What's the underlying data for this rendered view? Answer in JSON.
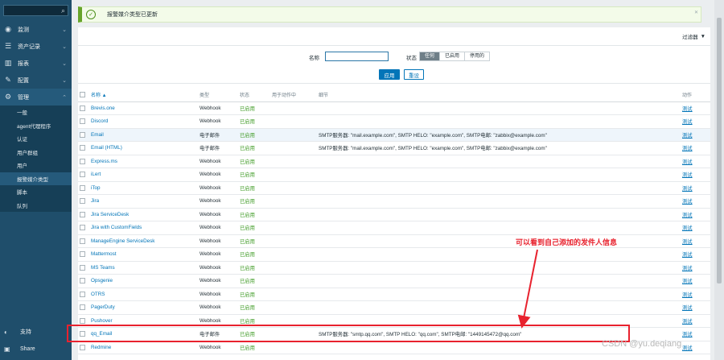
{
  "sidebar": {
    "search_placeholder": "",
    "nav": [
      {
        "label": "监测",
        "icon": "eye-icon",
        "glyph": "◉"
      },
      {
        "label": "资产记录",
        "icon": "list-icon",
        "glyph": "☰"
      },
      {
        "label": "报表",
        "icon": "bar-chart-icon",
        "glyph": "▥"
      },
      {
        "label": "配置",
        "icon": "wrench-icon",
        "glyph": "✎"
      },
      {
        "label": "管理",
        "icon": "gear-icon",
        "glyph": "⚙"
      }
    ],
    "sub_items": [
      "一般",
      "agent代理程序",
      "认证",
      "用户群组",
      "用户",
      "报警媒介类型",
      "脚本",
      "队列"
    ],
    "selected_sub": "报警媒介类型",
    "footer": [
      {
        "label": "支持",
        "icon": "support-icon",
        "glyph": "◐"
      },
      {
        "label": "Share",
        "icon": "share-icon",
        "glyph": "▣"
      }
    ]
  },
  "message": {
    "text": "报警媒介类型已更新"
  },
  "filter": {
    "button_label": "过滤器",
    "name_label": "名称",
    "name_value": "",
    "status_label": "状态",
    "status_options": [
      "任何",
      "已启用",
      "停用的"
    ],
    "status_selected": "任何",
    "apply_label": "应用",
    "reset_label": "重设"
  },
  "table": {
    "columns": [
      "名称 ▲",
      "类型",
      "状态",
      "用于动作中",
      "细节",
      "动作"
    ],
    "rows": [
      {
        "name": "Brevis.one",
        "type": "Webhook",
        "status": "已启用",
        "details": "",
        "action": "测试"
      },
      {
        "name": "Discord",
        "type": "Webhook",
        "status": "已启用",
        "details": "",
        "action": "测试"
      },
      {
        "name": "Email",
        "type": "电子邮件",
        "status": "已启用",
        "details": "SMTP服务器: \"mail.example.com\", SMTP HELO: \"example.com\", SMTP电邮: \"zabbix@example.com\"",
        "action": "测试"
      },
      {
        "name": "Email (HTML)",
        "type": "电子邮件",
        "status": "已启用",
        "details": "SMTP服务器: \"mail.example.com\", SMTP HELO: \"example.com\", SMTP电邮: \"zabbix@example.com\"",
        "action": "测试"
      },
      {
        "name": "Express.ms",
        "type": "Webhook",
        "status": "已启用",
        "details": "",
        "action": "测试"
      },
      {
        "name": "iLert",
        "type": "Webhook",
        "status": "已启用",
        "details": "",
        "action": "测试"
      },
      {
        "name": "iTop",
        "type": "Webhook",
        "status": "已启用",
        "details": "",
        "action": "测试"
      },
      {
        "name": "Jira",
        "type": "Webhook",
        "status": "已启用",
        "details": "",
        "action": "测试"
      },
      {
        "name": "Jira ServiceDesk",
        "type": "Webhook",
        "status": "已启用",
        "details": "",
        "action": "测试"
      },
      {
        "name": "Jira with CustomFields",
        "type": "Webhook",
        "status": "已启用",
        "details": "",
        "action": "测试"
      },
      {
        "name": "ManageEngine ServiceDesk",
        "type": "Webhook",
        "status": "已启用",
        "details": "",
        "action": "测试"
      },
      {
        "name": "Mattermost",
        "type": "Webhook",
        "status": "已启用",
        "details": "",
        "action": "测试"
      },
      {
        "name": "MS Teams",
        "type": "Webhook",
        "status": "已启用",
        "details": "",
        "action": "测试"
      },
      {
        "name": "Opsgenie",
        "type": "Webhook",
        "status": "已启用",
        "details": "",
        "action": "测试"
      },
      {
        "name": "OTRS",
        "type": "Webhook",
        "status": "已启用",
        "details": "",
        "action": "测试"
      },
      {
        "name": "PagerDuty",
        "type": "Webhook",
        "status": "已启用",
        "details": "",
        "action": "测试"
      },
      {
        "name": "Pushover",
        "type": "Webhook",
        "status": "已启用",
        "details": "",
        "action": "测试"
      },
      {
        "name": "qq_Email",
        "type": "电子邮件",
        "status": "已启用",
        "details": "SMTP服务器: \"smtp.qq.com\", SMTP HELO: \"qq.com\", SMTP电邮: \"1449145472@qq.com\"",
        "action": "测试"
      },
      {
        "name": "Redmine",
        "type": "Webhook",
        "status": "已启用",
        "details": "",
        "action": "测试"
      }
    ],
    "highlight_row": 2,
    "boxed_row": 17
  },
  "annotation": {
    "text": "可以看到自己添加的发件人信息",
    "color": "#e8222e"
  },
  "watermark": "CSDN @yu.deqiang",
  "colors": {
    "sidebar": "#1f4e6b",
    "link": "#0275b8",
    "enabled": "#3f9b25",
    "primary": "#0275b8"
  }
}
